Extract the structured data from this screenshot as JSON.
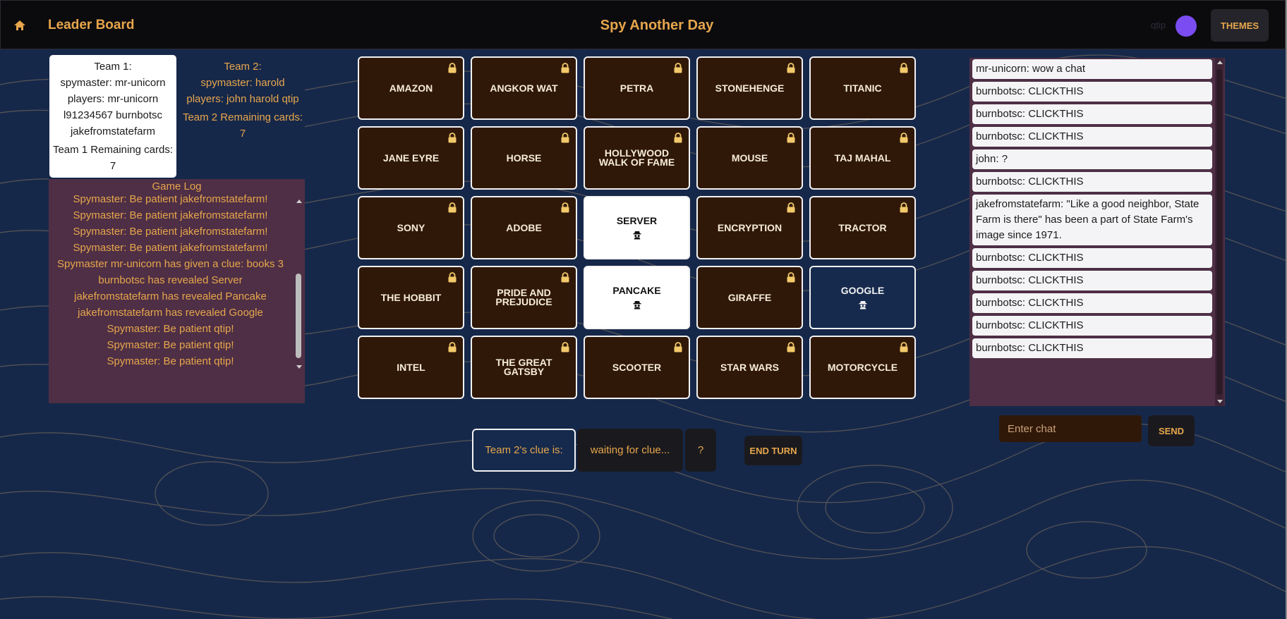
{
  "header": {
    "nav_title": "Leader Board",
    "app_title": "Spy Another Day",
    "user_name": "qtip",
    "themes_label": "THEMES"
  },
  "teams": {
    "team1": {
      "title": "Team 1:",
      "spymaster": "spymaster: mr-unicorn",
      "players": "players: mr-unicorn l91234567  burnbotsc jakefromstatefarm",
      "remaining": "Team 1 Remaining cards: 7"
    },
    "team2": {
      "title": "Team 2:",
      "spymaster": "spymaster: harold",
      "players": "players: john  harold qtip",
      "remaining": "Team 2 Remaining cards: 7"
    }
  },
  "game_log": {
    "title": "Game Log",
    "entries": [
      "Spymaster: Be patient jakefromstatefarm!",
      "Spymaster: Be patient jakefromstatefarm!",
      "Spymaster: Be patient jakefromstatefarm!",
      "Spymaster: Be patient jakefromstatefarm!",
      "Spymaster mr-unicorn has given a clue: books 3",
      "burnbotsc has revealed Server",
      "jakefromstatefarm has revealed Pancake",
      "jakefromstatefarm has revealed Google",
      "Spymaster: Be patient qtip!",
      "Spymaster: Be patient qtip!",
      "Spymaster: Be patient qtip!"
    ]
  },
  "board": {
    "cards": [
      {
        "word": "AMAZON",
        "state": "locked"
      },
      {
        "word": "ANGKOR WAT",
        "state": "locked"
      },
      {
        "word": "PETRA",
        "state": "locked"
      },
      {
        "word": "STONEHENGE",
        "state": "locked"
      },
      {
        "word": "TITANIC",
        "state": "locked"
      },
      {
        "word": "JANE EYRE",
        "state": "locked"
      },
      {
        "word": "HORSE",
        "state": "locked"
      },
      {
        "word": "HOLLYWOOD WALK OF FAME",
        "state": "locked"
      },
      {
        "word": "MOUSE",
        "state": "locked"
      },
      {
        "word": "TAJ MAHAL",
        "state": "locked"
      },
      {
        "word": "SONY",
        "state": "locked"
      },
      {
        "word": "ADOBE",
        "state": "locked"
      },
      {
        "word": "SERVER",
        "state": "revealed-neutral"
      },
      {
        "word": "ENCRYPTION",
        "state": "locked"
      },
      {
        "word": "TRACTOR",
        "state": "locked"
      },
      {
        "word": "THE HOBBIT",
        "state": "locked"
      },
      {
        "word": "PRIDE AND PREJUDICE",
        "state": "locked"
      },
      {
        "word": "PANCAKE",
        "state": "revealed-neutral"
      },
      {
        "word": "GIRAFFE",
        "state": "locked"
      },
      {
        "word": "GOOGLE",
        "state": "revealed-blue"
      },
      {
        "word": "INTEL",
        "state": "locked"
      },
      {
        "word": "THE GREAT GATSBY",
        "state": "locked"
      },
      {
        "word": "SCOOTER",
        "state": "locked"
      },
      {
        "word": "STAR WARS",
        "state": "locked"
      },
      {
        "word": "MOTORCYCLE",
        "state": "locked"
      }
    ]
  },
  "clue": {
    "team_label": "Team 2's clue is:",
    "word": "waiting for clue...",
    "count": "?",
    "end_turn_label": "END TURN"
  },
  "chat": {
    "messages": [
      "mr-unicorn: wow a chat",
      "burnbotsc: CLICKTHIS",
      "burnbotsc: CLICKTHIS",
      "burnbotsc: CLICKTHIS",
      "john: ?",
      "burnbotsc: CLICKTHIS",
      "jakefromstatefarm: \"Like a good neighbor, State Farm is there\" has been a part of State Farm's image since 1971.",
      "burnbotsc: CLICKTHIS",
      "burnbotsc: CLICKTHIS",
      "burnbotsc: CLICKTHIS",
      "burnbotsc: CLICKTHIS",
      "burnbotsc: CLICKTHIS"
    ],
    "input_placeholder": "Enter chat",
    "send_label": "SEND"
  },
  "colors": {
    "accent": "#e7a64c",
    "background": "#16284a",
    "card_locked": "#301808",
    "card_blue": "#152a4d",
    "log_panel": "#4e2f45"
  },
  "icons": {
    "home": "home-icon",
    "lock": "lock-icon",
    "spy": "spy-icon"
  }
}
